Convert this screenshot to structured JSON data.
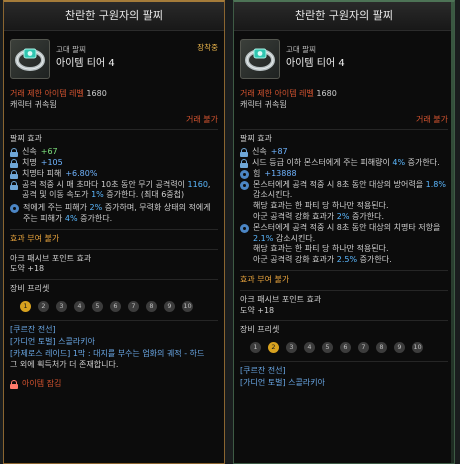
{
  "left": {
    "title": "찬란한 구원자의 팔찌",
    "grade": "고대 팔찌",
    "tier": "아이템 티어 4",
    "equipped": "장착중",
    "req_label": "거래 제한 아이템 레벨",
    "req_level": "1680",
    "bound": "캐릭터 귀속됨",
    "trade": "거래 불가",
    "effects_title": "팔찌 효과",
    "stats": [
      {
        "name": "신속",
        "value": "+67"
      },
      {
        "name": "치명",
        "value": "+105"
      },
      {
        "name": "치명타 피해",
        "value": "+6.80%"
      }
    ],
    "effect1_a": "공격 적중 시 매 초마다 10초 동안 무기 공격력이 ",
    "effect1_b": "1160",
    "effect1_c": ", 공격 및 이동 속도가 ",
    "effect1_d": "1%",
    "effect1_e": " 증가한다. (최대 6중첩)",
    "effect2_a": "적에게 주는 피해가 ",
    "effect2_b": "2%",
    "effect2_c": " 증가하며, 무력화 상태의 적에게 주는 피해가 ",
    "effect2_d": "4%",
    "effect2_e": " 증가한다.",
    "imbue_title": "효과 부여 불가",
    "ark_title": "아크 패시브 포인트 효과",
    "ark_value": "도약 +18",
    "preset_title": "장비 프리셋",
    "presets": [
      "1",
      "2",
      "3",
      "4",
      "5",
      "6",
      "7",
      "8",
      "9",
      "10"
    ],
    "preset_active": 0,
    "source_title": "[쿠르잔 전선]",
    "source_1": "[가디언 토벌] 스콜라키아",
    "source_2": "[카제로스 레이드] 1막 : 대지를 부수는 업화의 궤적 - 하드",
    "source_3": "그 외에 획득처가 더 존재합니다.",
    "bottom_note": "아이템 잠김"
  },
  "right": {
    "title": "찬란한 구원자의 팔찌",
    "grade": "고대 팔찌",
    "tier": "아이템 티어 4",
    "req_label": "거래 제한 아이템 레벨",
    "req_level": "1680",
    "bound": "캐릭터 귀속됨",
    "trade": "거래 불가",
    "effects_title": "팔찌 효과",
    "stat1_name": "신속",
    "stat1_value": "+87",
    "effect1_a": "시드 등급 이하 몬스터에게 주는 피해량이 ",
    "effect1_b": "4%",
    "effect1_c": " 증가한다.",
    "stat2_name": "힘",
    "stat2_value": "+13888",
    "effect2_a": "몬스터에게 공격 적중 시 8초 동안 대상의 방어력을 ",
    "effect2_b": "1.8%",
    "effect2_c": " 감소시킨다.",
    "effect2_d": "해당 효과는 한 파티 당 하나만 적용된다.",
    "effect2_e": "아군 공격력 강화 효과가 ",
    "effect2_f": "2%",
    "effect2_g": " 증가한다.",
    "effect3_a": "몬스터에게 공격 적중 시 8초 동안 대상의 치명타 저항을 ",
    "effect3_b": "2.1%",
    "effect3_c": " 감소시킨다.",
    "effect3_d": "해당 효과는 한 파티 당 하나만 적용된다.",
    "effect3_e": "아군 공격력 강화 효과가 ",
    "effect3_f": "2.5%",
    "effect3_g": " 증가한다.",
    "imbue_title": "효과 부여 불가",
    "ark_title": "아크 패시브 포인트 효과",
    "ark_value": "도약 +18",
    "preset_title": "장비 프리셋",
    "presets": [
      "1",
      "2",
      "3",
      "4",
      "5",
      "6",
      "7",
      "8",
      "9",
      "10"
    ],
    "preset_active": 1,
    "source_title": "[쿠르잔 전선]",
    "source_1": "[가디언 토벌] 스콜라키아"
  }
}
